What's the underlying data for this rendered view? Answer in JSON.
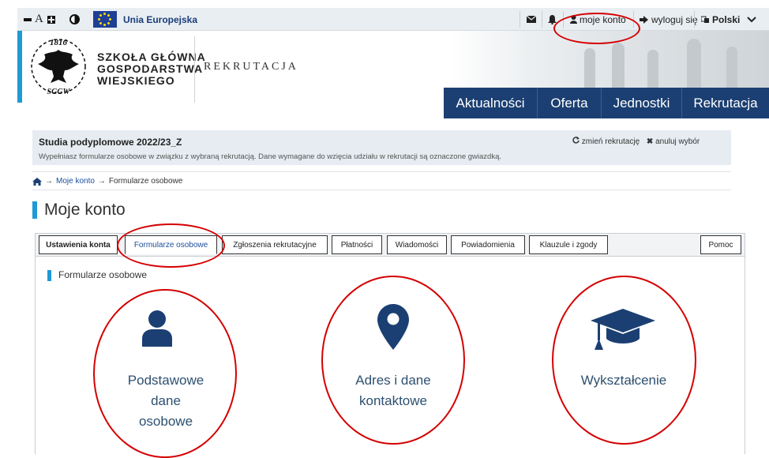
{
  "topbar": {
    "eu_label": "Unia Europejska",
    "account": "moje konto",
    "logout": "wyloguj się",
    "language": "Polski"
  },
  "header": {
    "school_line1": "SZKOŁA GŁÓWNA",
    "school_line2": "GOSPODARSTWA",
    "school_line3": "WIEJSKIEGO",
    "system_name": "REKRUTACJA",
    "logo_year": "1816",
    "logo_abbr": "SGGW"
  },
  "nav": [
    {
      "label": "Aktualności"
    },
    {
      "label": "Oferta"
    },
    {
      "label": "Jednostki"
    },
    {
      "label": "Rekrutacja"
    }
  ],
  "recruitment": {
    "title": "Studia podyplomowe 2022/23_Z",
    "subtitle": "Wypełniasz formularze osobowe w związku z wybraną rekrutacją. Dane wymagane do wzięcia udziału w rekrutacji są oznaczone gwiazdką.",
    "change": "zmień rekrutację",
    "cancel": "anuluj wybór"
  },
  "breadcrumb": {
    "account": "Moje konto",
    "current": "Formularze osobowe"
  },
  "page_title": "Moje konto",
  "tabs": [
    {
      "label": "Ustawienia konta"
    },
    {
      "label": "Formularze osobowe"
    },
    {
      "label": "Zgłoszenia rekrutacyjne"
    },
    {
      "label": "Płatności"
    },
    {
      "label": "Wiadomości"
    },
    {
      "label": "Powiadomienia"
    },
    {
      "label": "Klauzule i zgody"
    },
    {
      "label": "Pomoc"
    }
  ],
  "section_title": "Formularze osobowe",
  "cards": [
    {
      "line1": "Podstawowe",
      "line2": "dane",
      "line3": "osobowe",
      "icon": "person-icon"
    },
    {
      "line1": "Adres i dane",
      "line2": "kontaktowe",
      "icon": "location-pin-icon"
    },
    {
      "line1": "Wykształcenie",
      "icon": "graduation-cap-icon"
    }
  ],
  "colors": {
    "navy": "#1b3f72",
    "accent_blue": "#1f9ad6",
    "annotation_red": "#d40000"
  }
}
